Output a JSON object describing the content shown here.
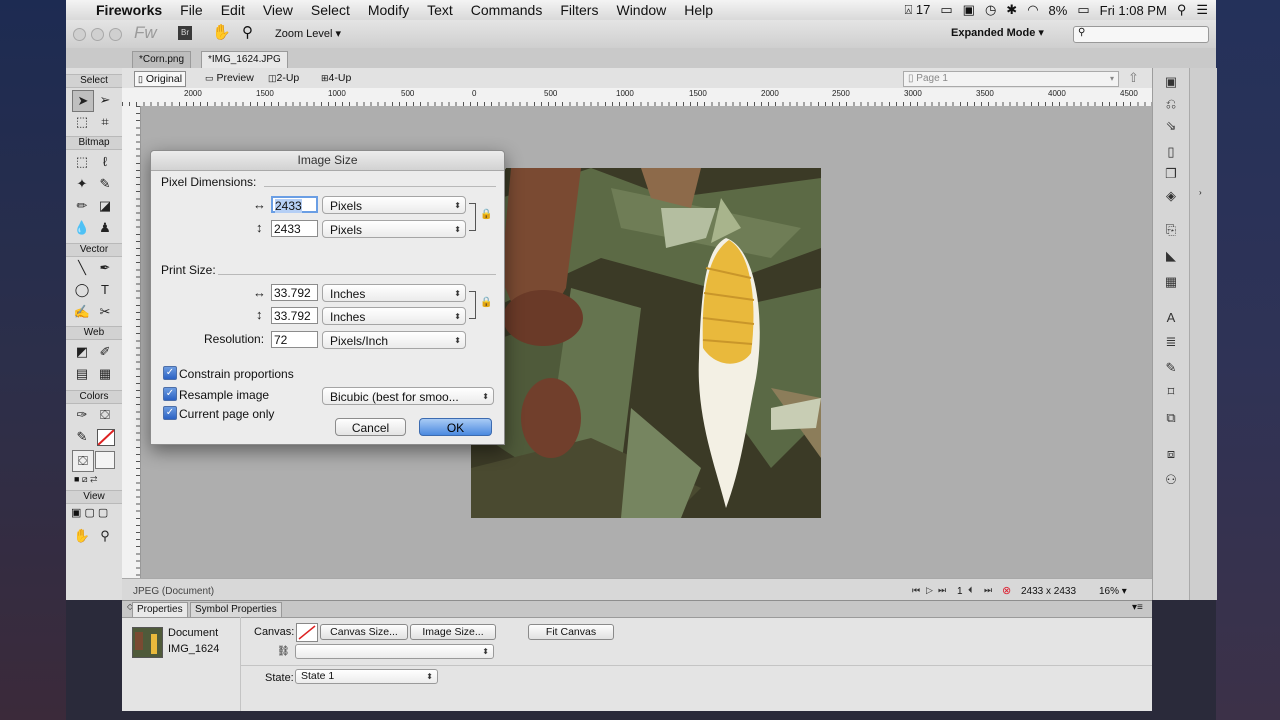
{
  "menubar": {
    "app_name": "Fireworks",
    "items": [
      "File",
      "Edit",
      "View",
      "Select",
      "Modify",
      "Text",
      "Commands",
      "Filters",
      "Window",
      "Help"
    ],
    "status": {
      "adobe_count": "17",
      "battery": "8%",
      "clock": "Fri 1:08 PM"
    }
  },
  "appbar": {
    "logo": "Fw",
    "bridge": "Br",
    "zoom_level_label": "Zoom Level",
    "mode": "Expanded Mode"
  },
  "doc_tabs": [
    "*Corn.png",
    "*IMG_1624.JPG"
  ],
  "toolbar": {
    "sections": {
      "select": "Select",
      "bitmap": "Bitmap",
      "vector": "Vector",
      "web": "Web",
      "colors": "Colors",
      "view": "View"
    }
  },
  "viewbar": {
    "views": [
      "Original",
      "Preview",
      "2-Up",
      "4-Up"
    ],
    "page": "Page 1"
  },
  "ruler": {
    "labels": [
      "2000",
      "1500",
      "1000",
      "500",
      "0",
      "500",
      "1000",
      "1500",
      "2000",
      "2500",
      "3000",
      "3500",
      "4000",
      "4500"
    ]
  },
  "status": {
    "doc_type": "JPEG (Document)",
    "frame": "1",
    "dimensions": "2433 x 2433",
    "zoom": "16%"
  },
  "properties": {
    "tabs": [
      "Properties",
      "Symbol Properties"
    ],
    "doc_label": "Document",
    "doc_name": "IMG_1624",
    "canvas_label": "Canvas:",
    "canvas_size_btn": "Canvas Size...",
    "image_size_btn": "Image Size...",
    "fit_canvas_btn": "Fit Canvas",
    "state_label": "State:",
    "state_value": "State 1"
  },
  "dialog": {
    "title": "Image Size",
    "pixel_dimensions_label": "Pixel Dimensions:",
    "pixel_width": "2433",
    "pixel_height": "2433",
    "pixel_unit": "Pixels",
    "print_size_label": "Print Size:",
    "print_width": "33.792",
    "print_height": "33.792",
    "print_unit": "Inches",
    "resolution_label": "Resolution:",
    "resolution_value": "72",
    "resolution_unit": "Pixels/Inch",
    "constrain_label": "Constrain proportions",
    "resample_label": "Resample image",
    "resample_method": "Bicubic (best for smoo...",
    "current_page_label": "Current page only",
    "cancel": "Cancel",
    "ok": "OK"
  }
}
